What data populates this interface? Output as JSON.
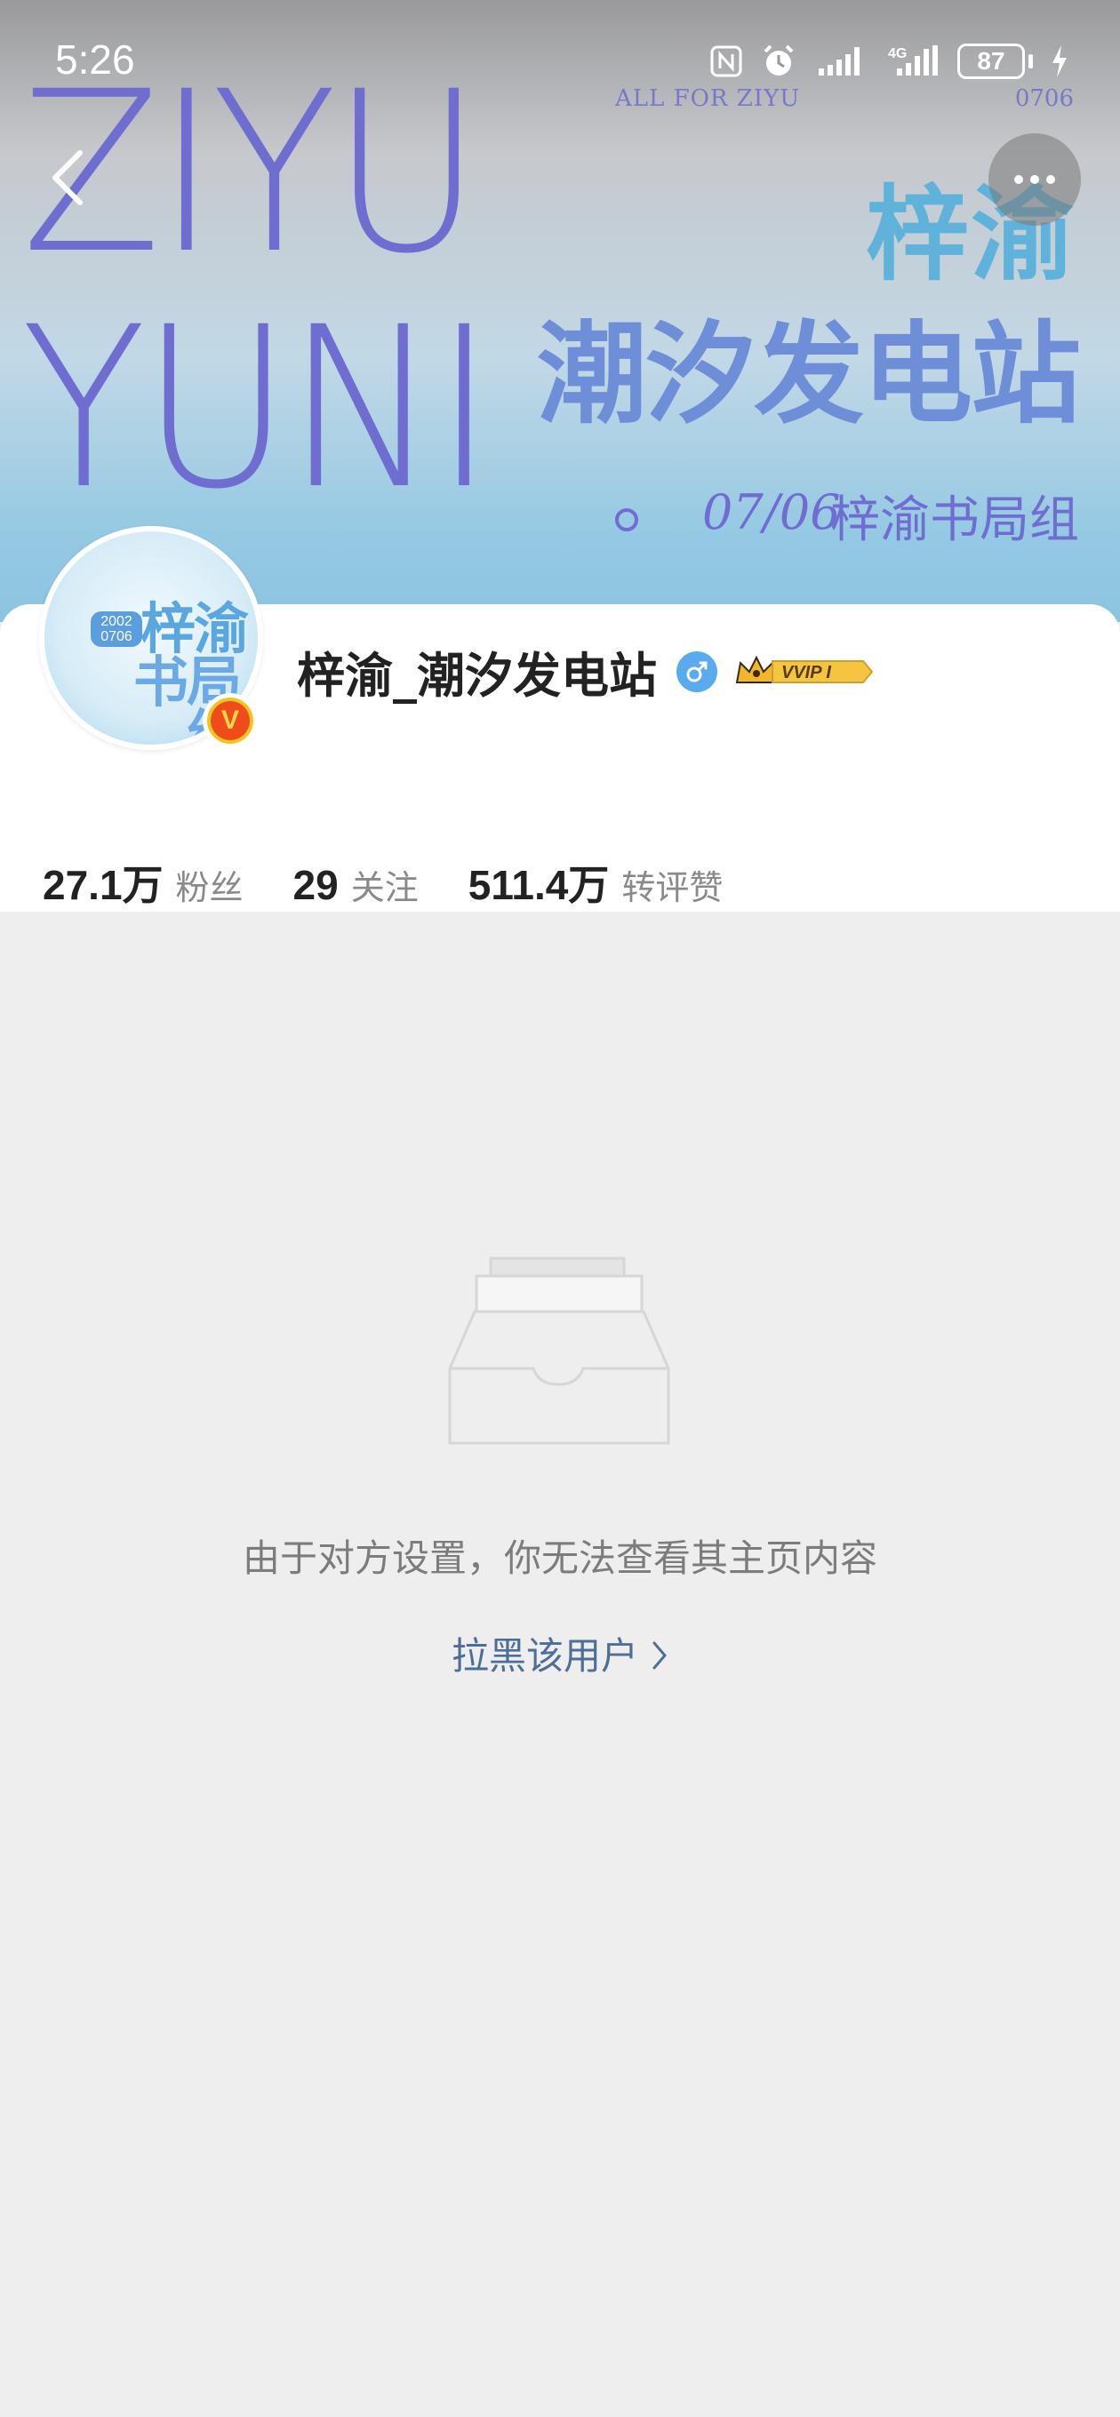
{
  "status_bar": {
    "time": "5:26",
    "battery": "87",
    "network": "4G",
    "icons": [
      "nfc-icon",
      "alarm-icon",
      "signal-icon",
      "signal-4g-icon",
      "battery-icon",
      "charging-icon"
    ]
  },
  "banner": {
    "line1": "ZIYU",
    "line2": "YUNI",
    "all_for": "ALL FOR ZIYU",
    "code": "0706",
    "cn_title_1": "梓渝",
    "cn_title_2": "潮汐发电站",
    "date": "07/06",
    "group": "梓渝书局组"
  },
  "nav": {
    "back_icon": "chevron-left-icon",
    "more_icon": "more-dots-icon"
  },
  "profile": {
    "avatar_date": "2002 0706",
    "avatar_text_1": "梓渝",
    "avatar_text_2": "书局组",
    "verified_mark": "V",
    "username": "梓渝_潮汐发电站",
    "gender": "male",
    "vvip_label": "VVIP I",
    "stats": [
      {
        "num": "27.1万",
        "label": "粉丝"
      },
      {
        "num": "29",
        "label": "关注"
      },
      {
        "num": "511.4万",
        "label": "转评赞"
      }
    ]
  },
  "empty_state": {
    "message": "由于对方设置，你无法查看其主页内容",
    "block_link": "拉黑该用户"
  },
  "colors": {
    "banner_purple": "#6f6dd0",
    "link_blue": "#4d6f97",
    "verified_orange": "#f04b1a",
    "vvip_gold": "#f5b92a"
  }
}
